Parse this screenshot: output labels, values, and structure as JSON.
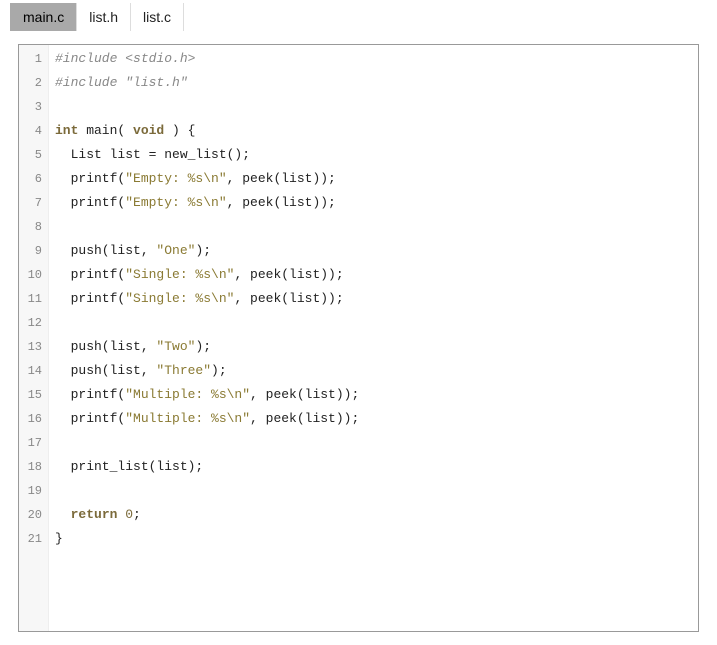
{
  "tabs": [
    {
      "label": "main.c",
      "active": true
    },
    {
      "label": "list.h",
      "active": false
    },
    {
      "label": "list.c",
      "active": false
    }
  ],
  "colors": {
    "tabActiveBg": "#a9a9a9",
    "gutterBg": "#f7f7f7",
    "border": "#999999",
    "preprocessor": "#888888",
    "keyword": "#7b6a3a",
    "string": "#8a7a33",
    "text": "#111111"
  },
  "code": {
    "lines": [
      {
        "n": 1,
        "tokens": [
          {
            "t": "#include <stdio.h>",
            "c": "pp"
          }
        ]
      },
      {
        "n": 2,
        "tokens": [
          {
            "t": "#include \"list.h\"",
            "c": "pp"
          }
        ]
      },
      {
        "n": 3,
        "tokens": []
      },
      {
        "n": 4,
        "tokens": [
          {
            "t": "int",
            "c": "kw"
          },
          {
            "t": " main( ",
            "c": "id"
          },
          {
            "t": "void",
            "c": "kw"
          },
          {
            "t": " ) {",
            "c": "punct"
          }
        ]
      },
      {
        "n": 5,
        "tokens": [
          {
            "t": "  List list = new_list();",
            "c": "id"
          }
        ]
      },
      {
        "n": 6,
        "tokens": [
          {
            "t": "  printf(",
            "c": "id"
          },
          {
            "t": "\"Empty: %s\\n\"",
            "c": "str"
          },
          {
            "t": ", peek(list));",
            "c": "id"
          }
        ]
      },
      {
        "n": 7,
        "tokens": [
          {
            "t": "  printf(",
            "c": "id"
          },
          {
            "t": "\"Empty: %s\\n\"",
            "c": "str"
          },
          {
            "t": ", peek(list));",
            "c": "id"
          }
        ]
      },
      {
        "n": 8,
        "tokens": []
      },
      {
        "n": 9,
        "tokens": [
          {
            "t": "  push(list, ",
            "c": "id"
          },
          {
            "t": "\"One\"",
            "c": "str"
          },
          {
            "t": ");",
            "c": "id"
          }
        ]
      },
      {
        "n": 10,
        "tokens": [
          {
            "t": "  printf(",
            "c": "id"
          },
          {
            "t": "\"Single: %s\\n\"",
            "c": "str"
          },
          {
            "t": ", peek(list));",
            "c": "id"
          }
        ]
      },
      {
        "n": 11,
        "tokens": [
          {
            "t": "  printf(",
            "c": "id"
          },
          {
            "t": "\"Single: %s\\n\"",
            "c": "str"
          },
          {
            "t": ", peek(list));",
            "c": "id"
          }
        ]
      },
      {
        "n": 12,
        "tokens": []
      },
      {
        "n": 13,
        "tokens": [
          {
            "t": "  push(list, ",
            "c": "id"
          },
          {
            "t": "\"Two\"",
            "c": "str"
          },
          {
            "t": ");",
            "c": "id"
          }
        ]
      },
      {
        "n": 14,
        "tokens": [
          {
            "t": "  push(list, ",
            "c": "id"
          },
          {
            "t": "\"Three\"",
            "c": "str"
          },
          {
            "t": ");",
            "c": "id"
          }
        ]
      },
      {
        "n": 15,
        "tokens": [
          {
            "t": "  printf(",
            "c": "id"
          },
          {
            "t": "\"Multiple: %s\\n\"",
            "c": "str"
          },
          {
            "t": ", peek(list));",
            "c": "id"
          }
        ]
      },
      {
        "n": 16,
        "tokens": [
          {
            "t": "  printf(",
            "c": "id"
          },
          {
            "t": "\"Multiple: %s\\n\"",
            "c": "str"
          },
          {
            "t": ", peek(list));",
            "c": "id"
          }
        ]
      },
      {
        "n": 17,
        "tokens": []
      },
      {
        "n": 18,
        "tokens": [
          {
            "t": "  print_list(list);",
            "c": "id"
          }
        ]
      },
      {
        "n": 19,
        "tokens": []
      },
      {
        "n": 20,
        "tokens": [
          {
            "t": "  ",
            "c": "id"
          },
          {
            "t": "return",
            "c": "kw"
          },
          {
            "t": " ",
            "c": "id"
          },
          {
            "t": "0",
            "c": "num"
          },
          {
            "t": ";",
            "c": "punct"
          }
        ]
      },
      {
        "n": 21,
        "tokens": [
          {
            "t": "}",
            "c": "punct"
          }
        ]
      }
    ]
  }
}
